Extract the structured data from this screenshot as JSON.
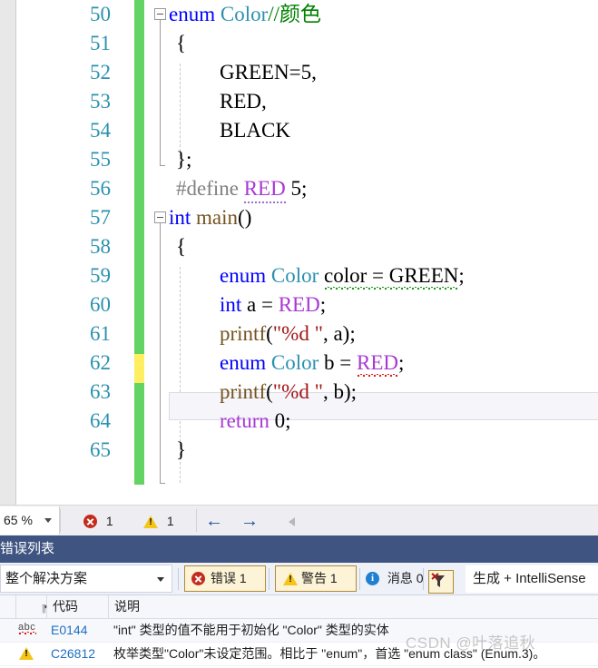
{
  "editor": {
    "zoom_level": "65 %",
    "lines": [
      {
        "no": "50",
        "text": "enum Color//颜色"
      },
      {
        "no": "51",
        "text": "{"
      },
      {
        "no": "52",
        "text": "    GREEN=5,"
      },
      {
        "no": "53",
        "text": "    RED,"
      },
      {
        "no": "54",
        "text": "    BLACK"
      },
      {
        "no": "55",
        "text": "};"
      },
      {
        "no": "56",
        "text": "#define RED 5;"
      },
      {
        "no": "57",
        "text": "int main()"
      },
      {
        "no": "58",
        "text": "{"
      },
      {
        "no": "59",
        "text": "    enum Color color = GREEN;"
      },
      {
        "no": "60",
        "text": "    int a = RED;"
      },
      {
        "no": "61",
        "text": "    printf(\"%d \", a);"
      },
      {
        "no": "62",
        "text": "    enum Color b = RED;"
      },
      {
        "no": "63",
        "text": "    printf(\"%d \", b);"
      },
      {
        "no": "64",
        "text": "    return 0;"
      },
      {
        "no": "65",
        "text": "}"
      }
    ],
    "tokens": {
      "l50_kw": "enum",
      "l50_type": "Color",
      "l50_cmt": "//颜色",
      "l51_brace": "{",
      "l52": "GREEN=5,",
      "l53": "RED,",
      "l54": "BLACK",
      "l55": "};",
      "l56_define": "#define",
      "l56_macro": "RED",
      "l56_num": "5;",
      "l57_kw": "int",
      "l57_fn": "main",
      "l57_paren": "()",
      "l58_brace": "{",
      "l59_kw": "enum",
      "l59_type": "Color",
      "l59_expr": "color = GREEN",
      "l59_semi": ";",
      "l60_kw": "int",
      "l60_mid": " a = ",
      "l60_macro": "RED",
      "l60_semi": ";",
      "l61_fn": "printf",
      "l61_open": "(",
      "l61_str": "\"%d \"",
      "l61_rest": ", a);",
      "l62_kw": "enum",
      "l62_type": "Color",
      "l62_mid": " b = ",
      "l62_macro": "RED",
      "l62_semi": ";",
      "l63_fn": "printf",
      "l63_open": "(",
      "l63_str": "\"%d \"",
      "l63_rest": ", b);",
      "l64_kw": "return",
      "l64_num": " 0;",
      "l65_brace": "}"
    }
  },
  "statusbar": {
    "zoom": "65 %",
    "error_count": "1",
    "warning_count": "1",
    "back_arrow": "←",
    "forward_arrow": "→"
  },
  "error_panel": {
    "title": "错误列表",
    "scope": "整个解决方案",
    "errors_toggle": "错误 1",
    "warnings_toggle": "警告 1",
    "messages_toggle": "消息 0",
    "build_filter": "生成 + IntelliSense",
    "columns": [
      "",
      "代码",
      "说明"
    ],
    "rows": [
      {
        "icon": "intellisense-abc-icon",
        "code": "E0144",
        "description": "\"int\" 类型的值不能用于初始化 \"Color\" 类型的实体"
      },
      {
        "icon": "warning-triangle-icon",
        "code": "C26812",
        "description": "枚举类型\"Color\"未设定范围。相比于 \"enum\"，首选 \"enum class\" (Enum.3)。"
      }
    ]
  },
  "watermark": "CSDN @叶落追秋",
  "colors": {
    "keyword": "#0000ff",
    "type": "#2b91af",
    "macro": "#a838d4",
    "comment": "#008000",
    "string": "#a31515",
    "function": "#74531f",
    "lineno": "#2b91af",
    "changebar_saved": "#63d463",
    "changebar_unsaved": "#ffee62",
    "panel_header": "#3f5480",
    "error_red": "#c42b1c",
    "warning_yellow": "#f5c518",
    "info_blue": "#1f7fd0",
    "link_blue": "#1f6fc4"
  }
}
